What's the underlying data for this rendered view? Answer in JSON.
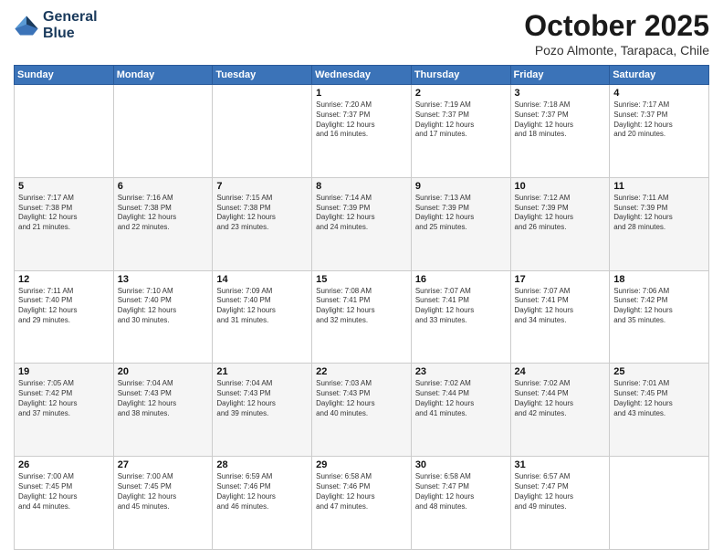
{
  "logo": {
    "line1": "General",
    "line2": "Blue"
  },
  "header": {
    "month": "October 2025",
    "location": "Pozo Almonte, Tarapaca, Chile"
  },
  "days_of_week": [
    "Sunday",
    "Monday",
    "Tuesday",
    "Wednesday",
    "Thursday",
    "Friday",
    "Saturday"
  ],
  "weeks": [
    [
      {
        "day": "",
        "info": ""
      },
      {
        "day": "",
        "info": ""
      },
      {
        "day": "",
        "info": ""
      },
      {
        "day": "1",
        "info": "Sunrise: 7:20 AM\nSunset: 7:37 PM\nDaylight: 12 hours\nand 16 minutes."
      },
      {
        "day": "2",
        "info": "Sunrise: 7:19 AM\nSunset: 7:37 PM\nDaylight: 12 hours\nand 17 minutes."
      },
      {
        "day": "3",
        "info": "Sunrise: 7:18 AM\nSunset: 7:37 PM\nDaylight: 12 hours\nand 18 minutes."
      },
      {
        "day": "4",
        "info": "Sunrise: 7:17 AM\nSunset: 7:37 PM\nDaylight: 12 hours\nand 20 minutes."
      }
    ],
    [
      {
        "day": "5",
        "info": "Sunrise: 7:17 AM\nSunset: 7:38 PM\nDaylight: 12 hours\nand 21 minutes."
      },
      {
        "day": "6",
        "info": "Sunrise: 7:16 AM\nSunset: 7:38 PM\nDaylight: 12 hours\nand 22 minutes."
      },
      {
        "day": "7",
        "info": "Sunrise: 7:15 AM\nSunset: 7:38 PM\nDaylight: 12 hours\nand 23 minutes."
      },
      {
        "day": "8",
        "info": "Sunrise: 7:14 AM\nSunset: 7:39 PM\nDaylight: 12 hours\nand 24 minutes."
      },
      {
        "day": "9",
        "info": "Sunrise: 7:13 AM\nSunset: 7:39 PM\nDaylight: 12 hours\nand 25 minutes."
      },
      {
        "day": "10",
        "info": "Sunrise: 7:12 AM\nSunset: 7:39 PM\nDaylight: 12 hours\nand 26 minutes."
      },
      {
        "day": "11",
        "info": "Sunrise: 7:11 AM\nSunset: 7:39 PM\nDaylight: 12 hours\nand 28 minutes."
      }
    ],
    [
      {
        "day": "12",
        "info": "Sunrise: 7:11 AM\nSunset: 7:40 PM\nDaylight: 12 hours\nand 29 minutes."
      },
      {
        "day": "13",
        "info": "Sunrise: 7:10 AM\nSunset: 7:40 PM\nDaylight: 12 hours\nand 30 minutes."
      },
      {
        "day": "14",
        "info": "Sunrise: 7:09 AM\nSunset: 7:40 PM\nDaylight: 12 hours\nand 31 minutes."
      },
      {
        "day": "15",
        "info": "Sunrise: 7:08 AM\nSunset: 7:41 PM\nDaylight: 12 hours\nand 32 minutes."
      },
      {
        "day": "16",
        "info": "Sunrise: 7:07 AM\nSunset: 7:41 PM\nDaylight: 12 hours\nand 33 minutes."
      },
      {
        "day": "17",
        "info": "Sunrise: 7:07 AM\nSunset: 7:41 PM\nDaylight: 12 hours\nand 34 minutes."
      },
      {
        "day": "18",
        "info": "Sunrise: 7:06 AM\nSunset: 7:42 PM\nDaylight: 12 hours\nand 35 minutes."
      }
    ],
    [
      {
        "day": "19",
        "info": "Sunrise: 7:05 AM\nSunset: 7:42 PM\nDaylight: 12 hours\nand 37 minutes."
      },
      {
        "day": "20",
        "info": "Sunrise: 7:04 AM\nSunset: 7:43 PM\nDaylight: 12 hours\nand 38 minutes."
      },
      {
        "day": "21",
        "info": "Sunrise: 7:04 AM\nSunset: 7:43 PM\nDaylight: 12 hours\nand 39 minutes."
      },
      {
        "day": "22",
        "info": "Sunrise: 7:03 AM\nSunset: 7:43 PM\nDaylight: 12 hours\nand 40 minutes."
      },
      {
        "day": "23",
        "info": "Sunrise: 7:02 AM\nSunset: 7:44 PM\nDaylight: 12 hours\nand 41 minutes."
      },
      {
        "day": "24",
        "info": "Sunrise: 7:02 AM\nSunset: 7:44 PM\nDaylight: 12 hours\nand 42 minutes."
      },
      {
        "day": "25",
        "info": "Sunrise: 7:01 AM\nSunset: 7:45 PM\nDaylight: 12 hours\nand 43 minutes."
      }
    ],
    [
      {
        "day": "26",
        "info": "Sunrise: 7:00 AM\nSunset: 7:45 PM\nDaylight: 12 hours\nand 44 minutes."
      },
      {
        "day": "27",
        "info": "Sunrise: 7:00 AM\nSunset: 7:45 PM\nDaylight: 12 hours\nand 45 minutes."
      },
      {
        "day": "28",
        "info": "Sunrise: 6:59 AM\nSunset: 7:46 PM\nDaylight: 12 hours\nand 46 minutes."
      },
      {
        "day": "29",
        "info": "Sunrise: 6:58 AM\nSunset: 7:46 PM\nDaylight: 12 hours\nand 47 minutes."
      },
      {
        "day": "30",
        "info": "Sunrise: 6:58 AM\nSunset: 7:47 PM\nDaylight: 12 hours\nand 48 minutes."
      },
      {
        "day": "31",
        "info": "Sunrise: 6:57 AM\nSunset: 7:47 PM\nDaylight: 12 hours\nand 49 minutes."
      },
      {
        "day": "",
        "info": ""
      }
    ]
  ]
}
